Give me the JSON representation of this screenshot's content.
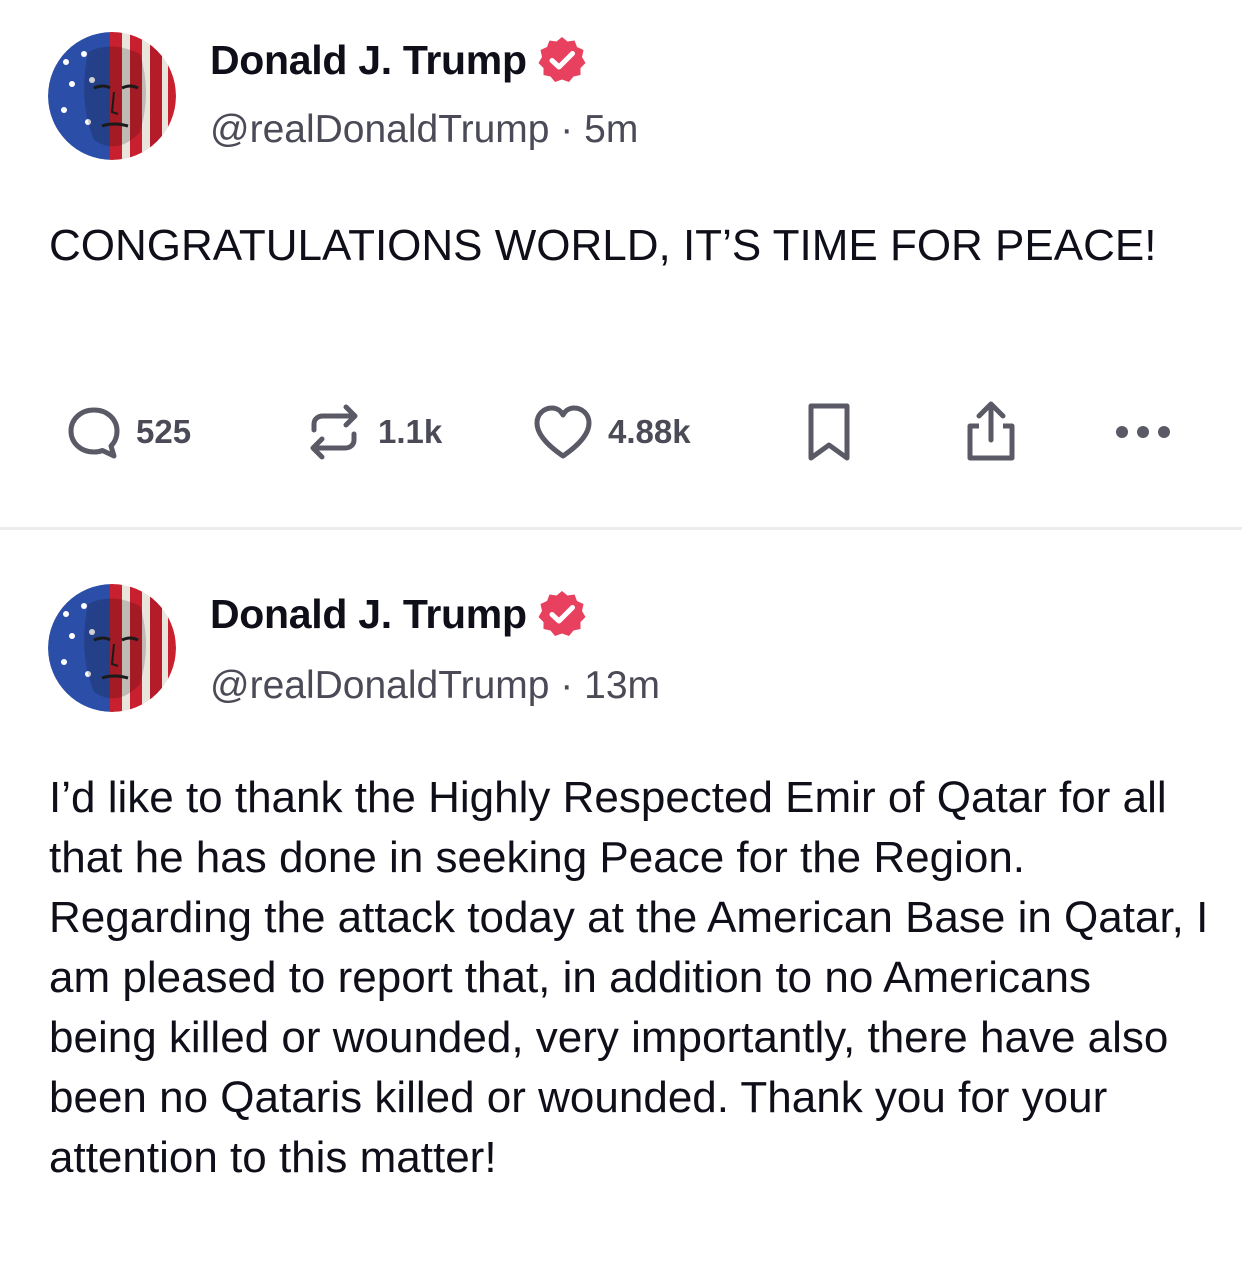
{
  "posts": [
    {
      "author": {
        "name": "Donald J. Trump",
        "handle": "@realDonaldTrump",
        "verified": true
      },
      "time": "5m",
      "separator": "·",
      "text": "CONGRATULATIONS WORLD, IT’S TIME FOR PEACE!",
      "stats": {
        "replies": "525",
        "reposts": "1.1k",
        "likes": "4.88k"
      }
    },
    {
      "author": {
        "name": "Donald J. Trump",
        "handle": "@realDonaldTrump",
        "verified": true
      },
      "time": "13m",
      "separator": "·",
      "text": "I’d like to thank the Highly Respected Emir of Qatar for all that he has done in seeking Peace for the Region. Regarding the attack today at the American Base in Qatar, I am pleased to report that, in addition to no Americans being killed or wounded, very importantly, there have also been no Qataris killed or wounded. Thank you for your attention to this matter!"
    }
  ],
  "icons": {
    "verified": "verified-badge-icon",
    "reply": "comment-bubble-icon",
    "repost": "repost-arrows-icon",
    "like": "heart-icon",
    "bookmark": "bookmark-icon",
    "share": "share-upload-icon",
    "more": "more-dots-icon"
  },
  "colors": {
    "verified": "#e8405f",
    "text": "#0f0f1a",
    "muted": "#4b4b57",
    "icon": "#5a5a66",
    "divider": "#ececef"
  }
}
